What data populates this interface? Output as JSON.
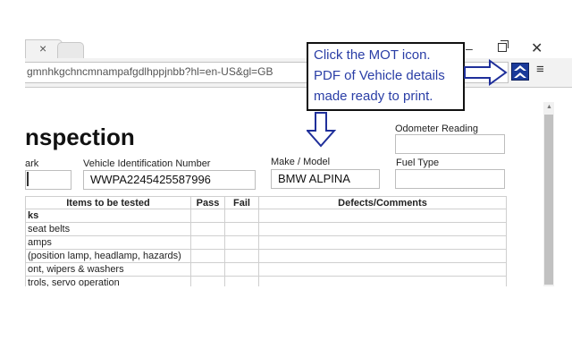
{
  "browser": {
    "tab_close_label": "×",
    "url": "gmnhkgchncmnampafgdlhppjnbb?hl=en-US&gl=GB",
    "window_minimize": "–",
    "window_close": "✕",
    "menu_label": "≡",
    "extension_icon": "mot-icon"
  },
  "callout": {
    "lines": [
      "Click the MOT icon.",
      "PDF of Vehicle details",
      "made ready to print."
    ]
  },
  "form": {
    "heading": "nspection",
    "fields": {
      "registration_label": "ark",
      "registration_value": "",
      "vin_label": "Vehicle Identification Number",
      "vin_value": "WWPA2245425587996",
      "make_model_label": "Make / Model",
      "make_model_value": "BMW ALPINA",
      "odometer_label": "Odometer Reading",
      "odometer_value": "",
      "fuel_type_label": "Fuel Type",
      "fuel_type_value": ""
    },
    "table": {
      "headers": [
        "Items to be tested",
        "Pass",
        "Fail",
        "Defects/Comments"
      ],
      "rows": [
        "ks",
        " seat belts",
        "amps",
        "(position lamp, headlamp, hazards)",
        "ont, wipers & washers",
        "trols, servo operation"
      ]
    }
  },
  "colors": {
    "callout_text": "#2a3ea6",
    "arrow": "#1f2f9a",
    "mot_icon_bg": "#1a3a9a"
  }
}
